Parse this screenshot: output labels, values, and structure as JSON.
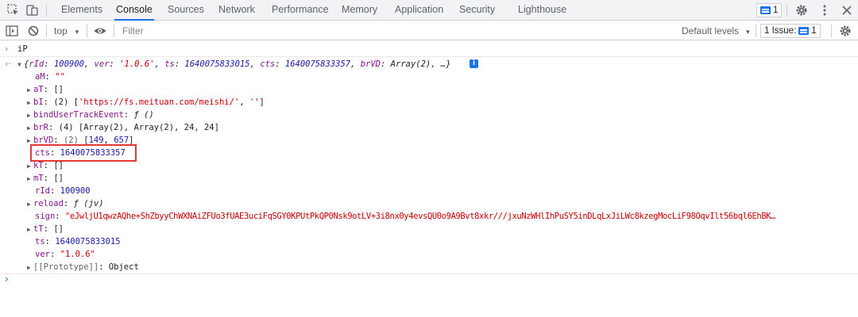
{
  "tabs": [
    "Elements",
    "Console",
    "Sources",
    "Network",
    "Performance",
    "Memory",
    "Application",
    "Security",
    "Lighthouse"
  ],
  "topbar": {
    "messages_count": "1"
  },
  "filterbar": {
    "context": "top",
    "filter_placeholder": "Filter",
    "levels": "Default levels",
    "issues_label": "1 Issue:",
    "issues_count": "1"
  },
  "console": {
    "input_expression": "iP",
    "summary": {
      "rId_key": "rId",
      "rId_val": "100900",
      "ver_key": "ver",
      "ver_val": "'1.0.6'",
      "ts_key": "ts",
      "ts_val": "1640075833015",
      "cts_key": "cts",
      "cts_val": "1640075833357",
      "brVD_key": "brVD",
      "brVD_val": "Array(2)",
      "tail": ", …}"
    },
    "props": {
      "aM_key": "aM",
      "aM_val": "\"\"",
      "aT_key": "aT",
      "aT_val": "[]",
      "bI_key": "bI",
      "bI_len": "(2)",
      "bI_a": "'https://fs.meituan.com/meishi/'",
      "bI_b": "''",
      "bute_key": "bindUserTrackEvent",
      "bute_val": "ƒ ()",
      "brR_key": "brR",
      "brR_val": "(4) [Array(2), Array(2), 24, 24]",
      "brVD_key": "brVD",
      "brVD_len": "(2)",
      "brVD_a": "149",
      "brVD_b": "657",
      "cts_key": "cts",
      "cts_val": "1640075833357",
      "kT_key": "kT",
      "kT_val": "[]",
      "mT_key": "mT",
      "mT_val": "[]",
      "rId_key": "rId",
      "rId_val": "100900",
      "reload_key": "reload",
      "reload_val": "ƒ (jv)",
      "sign_key": "sign",
      "sign_val": "\"eJwljU1qwzAQhe+ShZbyyChWXNAiZFUo3fUAE3uciFqSGY0KPUtPkQP0Nsk9otLV+3i8nx0y4evsQU0o9A9Bvt8xkr///jxuNzWHlIhPuSY5inDLqLxJiLWc8kzegMocLiF98OqvIlt56bql6EhBK…",
      "tT_key": "tT",
      "tT_val": "[]",
      "ts_key": "ts",
      "ts_val": "1640075833015",
      "ver_key": "ver",
      "ver_val": "\"1.0.6\"",
      "proto_key": "[[Prototype]]",
      "proto_val": "Object"
    }
  },
  "colors": {
    "accent": "#1a73e8",
    "highlight": "#e53935",
    "key": "#881391",
    "number": "#1a1aa6",
    "string": "#c80000"
  },
  "icons": [
    "inspect-element-icon",
    "device-toolbar-icon",
    "gear-icon",
    "kebab-menu-icon",
    "close-icon",
    "sidebar-toggle-icon",
    "clear-console-icon",
    "eye-icon",
    "info-icon"
  ]
}
